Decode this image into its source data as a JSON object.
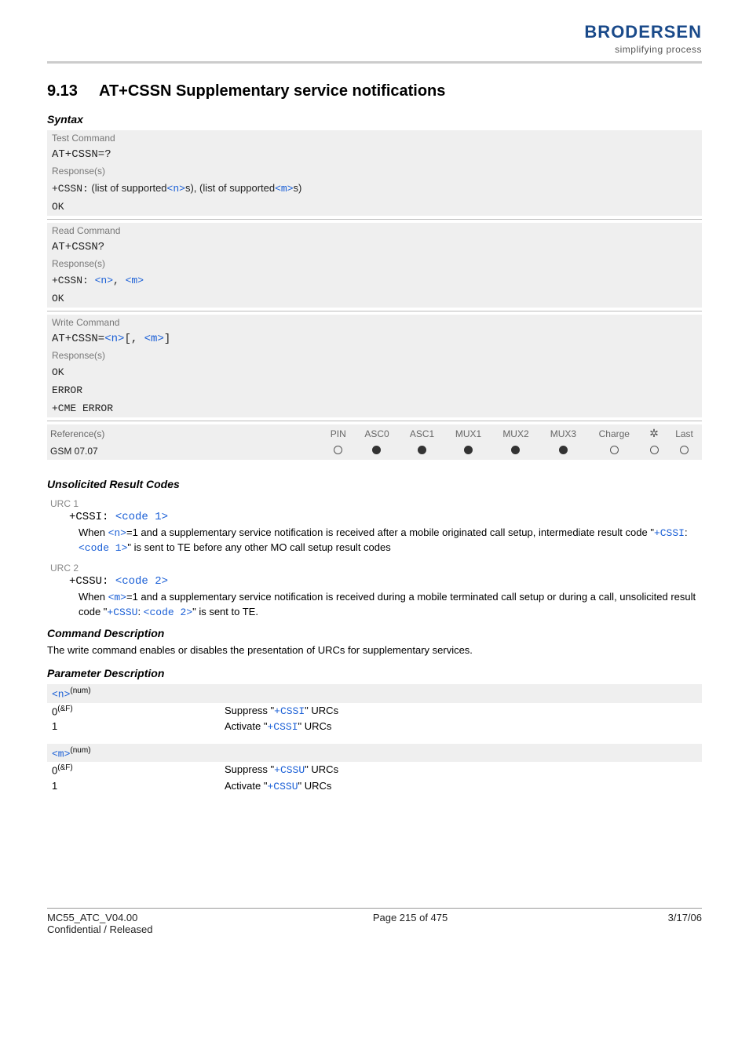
{
  "brand": {
    "name": "BRODERSEN",
    "tagline": "simplifying process"
  },
  "section": {
    "number": "9.13",
    "title": "AT+CSSN   Supplementary service notifications"
  },
  "syntax": {
    "heading": "Syntax",
    "test": {
      "label": "Test Command",
      "command": "AT+CSSN=?",
      "responses_label": "Response(s)",
      "response_prefix": "+CSSN:",
      "response_text1": "  (list of supported",
      "response_text2": "s), (list of supported",
      "response_text3": "s)",
      "ok": "OK"
    },
    "read": {
      "label": "Read Command",
      "command": "AT+CSSN?",
      "responses_label": "Response(s)",
      "response_prefix": "+CSSN: ",
      "ok": "OK"
    },
    "write": {
      "label": "Write Command",
      "command_prefix": "AT+CSSN=",
      "responses_label": "Response(s)",
      "ok": "OK",
      "error": "ERROR",
      "cme": "+CME ERROR"
    },
    "params": {
      "n": "<n>",
      "m": "<m>"
    }
  },
  "reference": {
    "label": "Reference(s)",
    "value": "GSM 07.07",
    "cols": [
      "PIN",
      "ASC0",
      "ASC1",
      "MUX1",
      "MUX2",
      "MUX3",
      "Charge",
      "",
      "Last"
    ],
    "states": [
      "empty",
      "fill",
      "fill",
      "fill",
      "fill",
      "fill",
      "empty",
      "empty",
      "empty"
    ]
  },
  "urc": {
    "heading": "Unsolicited Result Codes",
    "u1": {
      "label": "URC 1",
      "code_prefix": "+CSSI: ",
      "code1_ref": "<code 1>",
      "desc_pre": "When ",
      "desc_mid1": "=1 and a supplementary service notification is received after a mobile originated call setup, intermediate result code \"",
      "desc_cssi": "+CSSI",
      "desc_colonspace": ": ",
      "desc_mid2": "\" is sent to TE before any other MO call setup result codes"
    },
    "u2": {
      "label": "URC 2",
      "code_prefix": "+CSSU: ",
      "code2_ref": "<code 2>",
      "desc_pre": "When ",
      "desc_mid1": "=1 and a supplementary service notification is received during a mobile terminated call setup or during a call, unsolicited result code \"",
      "desc_cssu": "+CSSU",
      "desc_colonspace": ": ",
      "desc_mid2": "\" is sent to TE."
    }
  },
  "cmd_desc": {
    "heading": "Command Description",
    "text": "The write command enables or disables the presentation of URCs for supplementary services."
  },
  "param_desc": {
    "heading": "Parameter Description",
    "n": {
      "header_sup": "(num)",
      "rows": [
        {
          "val": "0",
          "val_sup": "(&F)",
          "pre": "Suppress \"",
          "link": "+CSSI",
          "post": "\" URCs"
        },
        {
          "val": "1",
          "val_sup": "",
          "pre": "Activate \"",
          "link": "+CSSI",
          "post": "\" URCs"
        }
      ]
    },
    "m": {
      "header_sup": "(num)",
      "rows": [
        {
          "val": "0",
          "val_sup": "(&F)",
          "pre": "Suppress \"",
          "link": "+CSSU",
          "post": "\" URCs"
        },
        {
          "val": "1",
          "val_sup": "",
          "pre": "Activate \"",
          "link": "+CSSU",
          "post": "\" URCs"
        }
      ]
    }
  },
  "footer": {
    "line1": "MC55_ATC_V04.00",
    "line2": "Confidential / Released",
    "center": "Page 215 of 475",
    "right": "3/17/06"
  }
}
